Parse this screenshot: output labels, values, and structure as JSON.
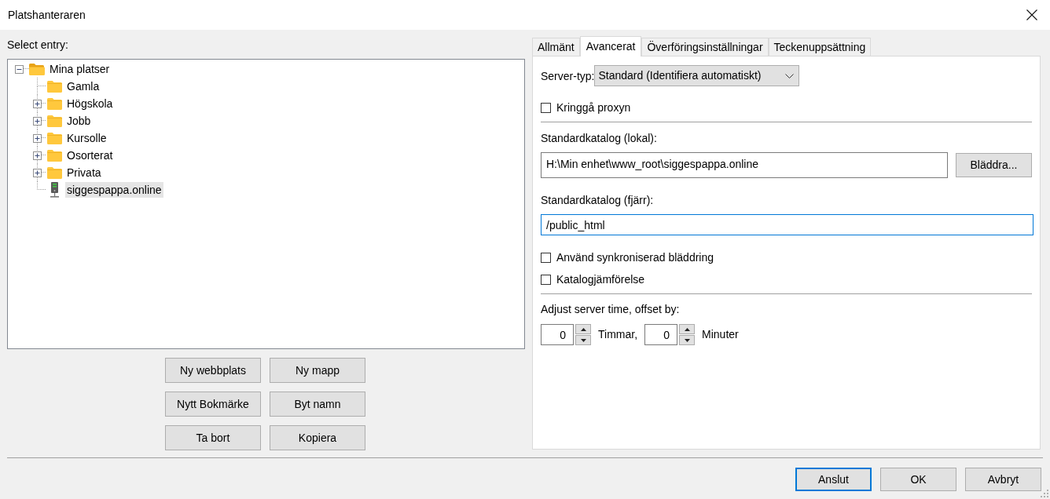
{
  "window": {
    "title": "Platshanteraren"
  },
  "site_tree": {
    "label": "Select entry:",
    "items": [
      {
        "label": "Mina platser",
        "kind": "folder",
        "expandable": true,
        "expanded": true,
        "selected": false,
        "children": [
          {
            "label": "Gamla",
            "kind": "folder",
            "expandable": false,
            "selected": false
          },
          {
            "label": "Högskola",
            "kind": "folder",
            "expandable": true,
            "expanded": false,
            "selected": false
          },
          {
            "label": "Jobb",
            "kind": "folder",
            "expandable": true,
            "expanded": false,
            "selected": false
          },
          {
            "label": "Kursolle",
            "kind": "folder",
            "expandable": true,
            "expanded": false,
            "selected": false
          },
          {
            "label": "Osorterat",
            "kind": "folder",
            "expandable": true,
            "expanded": false,
            "selected": false
          },
          {
            "label": "Privata",
            "kind": "folder",
            "expandable": true,
            "expanded": false,
            "selected": false
          },
          {
            "label": "siggespappa.online",
            "kind": "server",
            "expandable": false,
            "selected": true
          }
        ]
      }
    ]
  },
  "site_buttons": [
    "Ny webbplats",
    "Ny mapp",
    "Nytt Bokmärke",
    "Byt namn",
    "Ta bort",
    "Kopiera"
  ],
  "tabs": [
    {
      "label": "Allmänt",
      "selected": false
    },
    {
      "label": "Avancerat",
      "selected": true
    },
    {
      "label": "Överföringsinställningar",
      "selected": false
    },
    {
      "label": "Teckenuppsättning",
      "selected": false
    }
  ],
  "advanced": {
    "server_type": {
      "label": "Server-typ:",
      "value": "Standard (Identifiera automatiskt)"
    },
    "bypass_proxy": {
      "label": "Kringgå proxyn",
      "checked": false
    },
    "local_dir": {
      "label": "Standardkatalog (lokal):",
      "value": "H:\\Min enhet\\www_root\\siggespappa.online",
      "button": "Bläddra...",
      "focused": false
    },
    "remote_dir": {
      "label": "Standardkatalog (fjärr):",
      "value": "/public_html",
      "focused": true
    },
    "sync_browsing": {
      "label": "Använd synkroniserad bläddring",
      "checked": false
    },
    "dir_compare": {
      "label": "Katalogjämförelse",
      "checked": false
    },
    "time_offset": {
      "label": "Adjust server time, offset by:",
      "hours": {
        "value": "0",
        "unit": "Timmar,"
      },
      "minutes": {
        "value": "0",
        "unit": "Minuter"
      }
    }
  },
  "footer_buttons": [
    {
      "label": "Anslut",
      "default": true
    },
    {
      "label": "OK",
      "default": false
    },
    {
      "label": "Avbryt",
      "default": false
    }
  ]
}
